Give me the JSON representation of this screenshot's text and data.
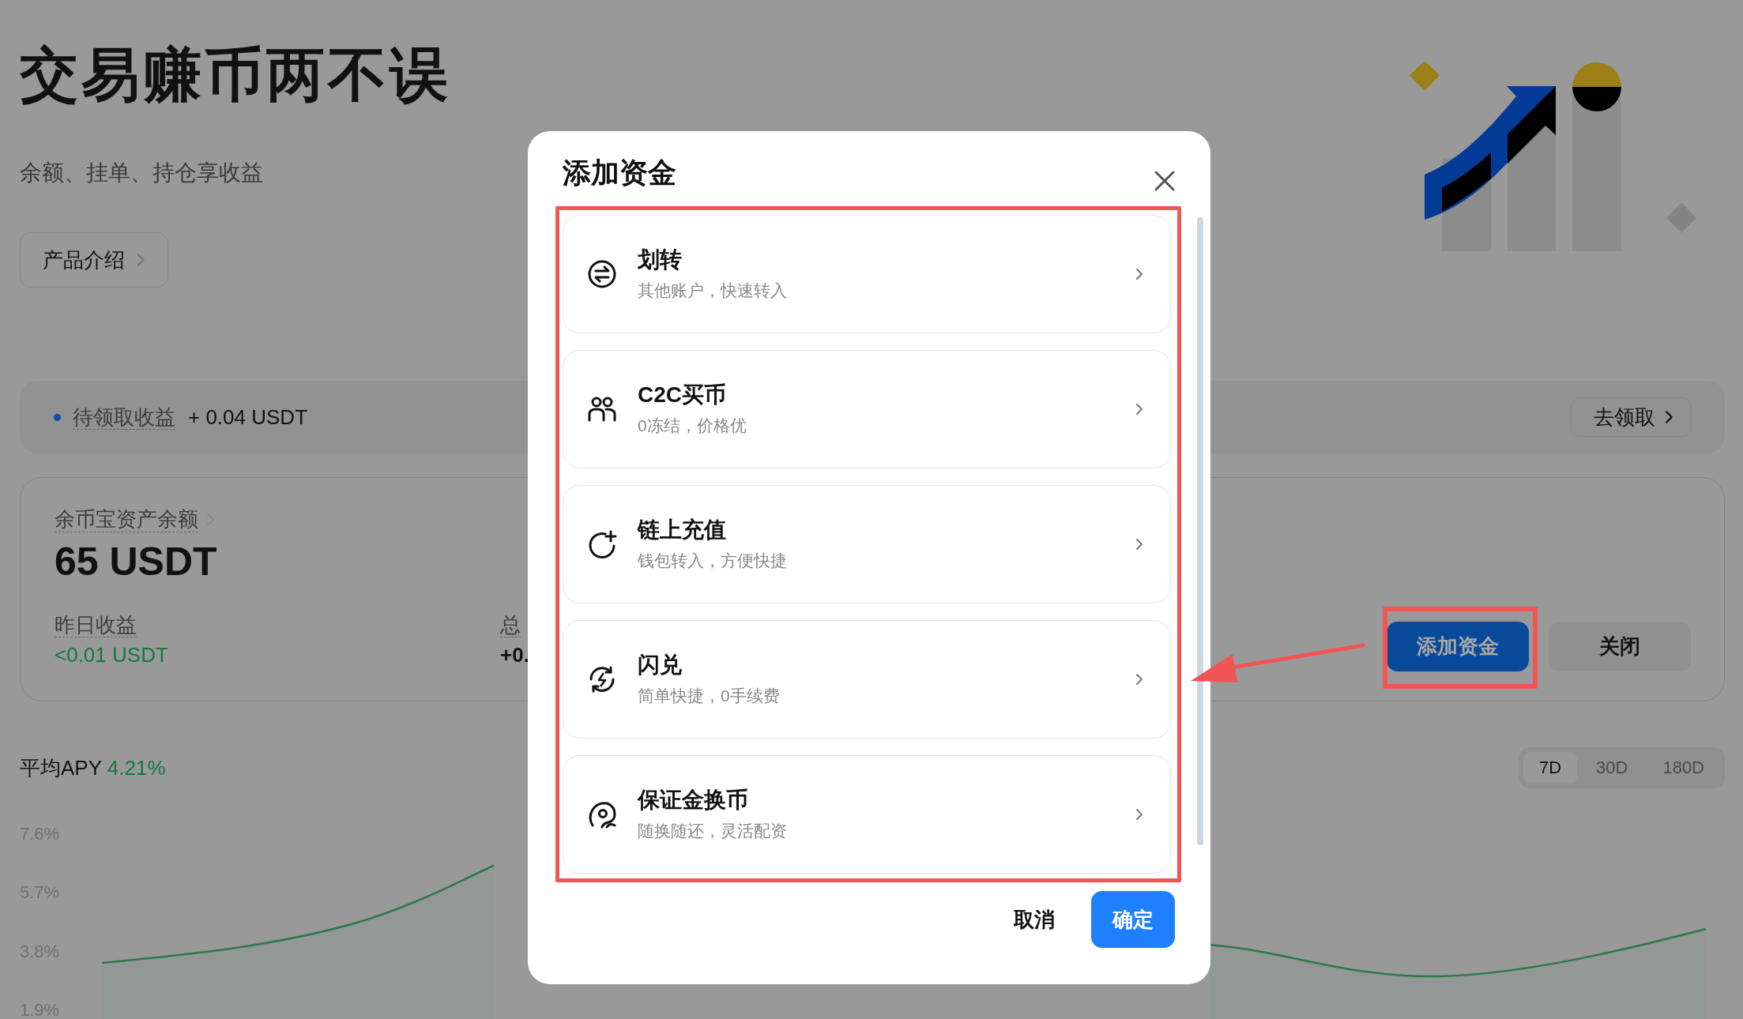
{
  "hero": {
    "title": "交易赚币两不误",
    "subtitle": "余额、挂单、持仓享收益",
    "intro_button": "产品介绍"
  },
  "pending": {
    "label": "待领取收益",
    "amount": "+ 0.04 USDT",
    "claim_button": "去领取"
  },
  "balance": {
    "label": "余币宝资产余额",
    "amount": "65 USDT",
    "stats": [
      {
        "label": "昨日收益",
        "value": "<0.01 USDT",
        "positive": true
      },
      {
        "label": "总",
        "value": "+0.",
        "positive": false
      }
    ],
    "buttons": [
      {
        "label": "添加资金",
        "kind": "primary",
        "highlighted": true
      },
      {
        "label": "关闭",
        "kind": "secondary",
        "highlighted": false
      }
    ]
  },
  "apy": {
    "label": "平均APY",
    "value": "4.21%",
    "ranges": [
      {
        "label": "7D",
        "selected": true
      },
      {
        "label": "30D",
        "selected": false
      },
      {
        "label": "180D",
        "selected": false
      }
    ],
    "axis_labels": [
      "7.6%",
      "5.7%",
      "3.8%",
      "1.9%"
    ]
  },
  "dialog": {
    "title": "添加资金",
    "options_highlighted": true,
    "options": [
      {
        "kind": "transfer",
        "title": "划转",
        "subtitle": "其他账户，快速转入"
      },
      {
        "kind": "p2p",
        "title": "C2C买币",
        "subtitle": "0冻结，价格优"
      },
      {
        "kind": "deposit",
        "title": "链上充值",
        "subtitle": "钱包转入，方便快捷"
      },
      {
        "kind": "convert",
        "title": "闪兑",
        "subtitle": "简单快捷，0手续费"
      },
      {
        "kind": "margin",
        "title": "保证金换币",
        "subtitle": "随换随还，灵活配资"
      }
    ],
    "cancel": "取消",
    "confirm": "确定"
  }
}
